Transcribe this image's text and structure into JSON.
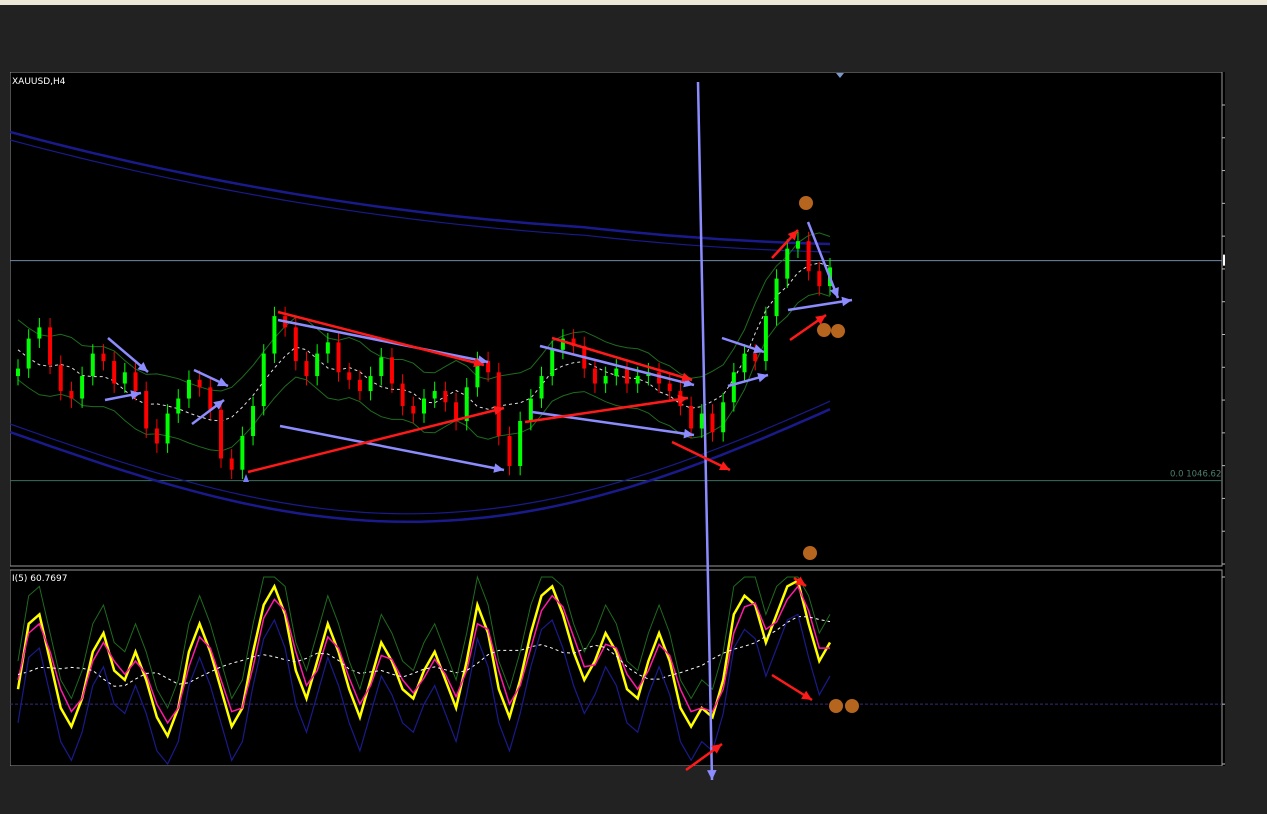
{
  "window": {
    "symbol_label": "XAUUSD,H4"
  },
  "indicator": {
    "label": "I(5) 60.7697"
  },
  "chart_data": [
    {
      "type": "candlestick",
      "title": "XAUUSD,H4",
      "ylim": [
        1023.84,
        1146.34
      ],
      "y_ticks": [
        "1146.34",
        "1137.59",
        "1128.84",
        "1120.09",
        "1111.34",
        "1102.59",
        "1093.84",
        "1085.09",
        "1076.34",
        "1067.59",
        "1058.84",
        "1050.09",
        "1041.34",
        "1032.59",
        "1023.84"
      ],
      "current_price": "1104.00",
      "level_line": {
        "label": "0.0 1046.62",
        "value": 1046.62
      },
      "close_series": [
        1076,
        1084,
        1087,
        1077,
        1070,
        1068,
        1074,
        1080,
        1078,
        1072,
        1075,
        1070,
        1060,
        1056,
        1064,
        1068,
        1073,
        1071,
        1065,
        1052,
        1049,
        1058,
        1066,
        1080,
        1090,
        1087,
        1078,
        1074,
        1080,
        1083,
        1075,
        1073,
        1070,
        1074,
        1079,
        1072,
        1066,
        1064,
        1068,
        1070,
        1067,
        1062,
        1071,
        1078,
        1075,
        1058,
        1050,
        1062,
        1068,
        1074,
        1081,
        1084,
        1082,
        1076,
        1072,
        1074,
        1076,
        1072,
        1074,
        1075,
        1072,
        1070,
        1066,
        1060,
        1064,
        1059,
        1067,
        1075,
        1080,
        1078,
        1090,
        1100,
        1108,
        1110,
        1102,
        1098,
        1103
      ],
      "colors": {
        "bull": "#00ff00",
        "bear": "#ff0000",
        "background": "#000000",
        "bands": "#1a1a8c",
        "envelope": "#1e6b1e",
        "arrow_blue": "#8c8cff",
        "arrow_red": "#ff1a1a",
        "marker": "#b5651d"
      }
    },
    {
      "type": "line",
      "title": "I(5) 60.7697",
      "ylim": [
        0,
        100
      ],
      "y_ticks": [
        "100",
        "32",
        "0"
      ],
      "level": 32,
      "series": [
        {
          "values": [
            40,
            75,
            80,
            55,
            30,
            20,
            35,
            60,
            70,
            50,
            45,
            60,
            45,
            25,
            15,
            30,
            60,
            75,
            60,
            40,
            20,
            30,
            60,
            85,
            95,
            80,
            50,
            35,
            55,
            75,
            60,
            40,
            25,
            45,
            65,
            55,
            40,
            35,
            50,
            60,
            45,
            30,
            55,
            85,
            70,
            40,
            25,
            45,
            70,
            90,
            95,
            80,
            60,
            45,
            55,
            70,
            60,
            40,
            35,
            55,
            70,
            55,
            30,
            20,
            30,
            25,
            45,
            80,
            90,
            85,
            65,
            80,
            95,
            98,
            75,
            55,
            65
          ],
          "color": "#ffff00"
        },
        {
          "values": [
            45,
            70,
            75,
            60,
            40,
            28,
            35,
            55,
            65,
            55,
            48,
            55,
            48,
            32,
            22,
            30,
            52,
            68,
            62,
            45,
            28,
            30,
            52,
            78,
            88,
            82,
            60,
            42,
            50,
            68,
            62,
            46,
            32,
            42,
            58,
            56,
            45,
            38,
            46,
            56,
            48,
            36,
            50,
            75,
            72,
            50,
            32,
            42,
            62,
            82,
            90,
            84,
            68,
            52,
            53,
            64,
            62,
            48,
            40,
            50,
            64,
            58,
            40,
            28,
            30,
            28,
            40,
            70,
            84,
            86,
            72,
            76,
            88,
            95,
            82,
            62,
            62
          ],
          "color": "#ff1aa6"
        }
      ]
    }
  ]
}
